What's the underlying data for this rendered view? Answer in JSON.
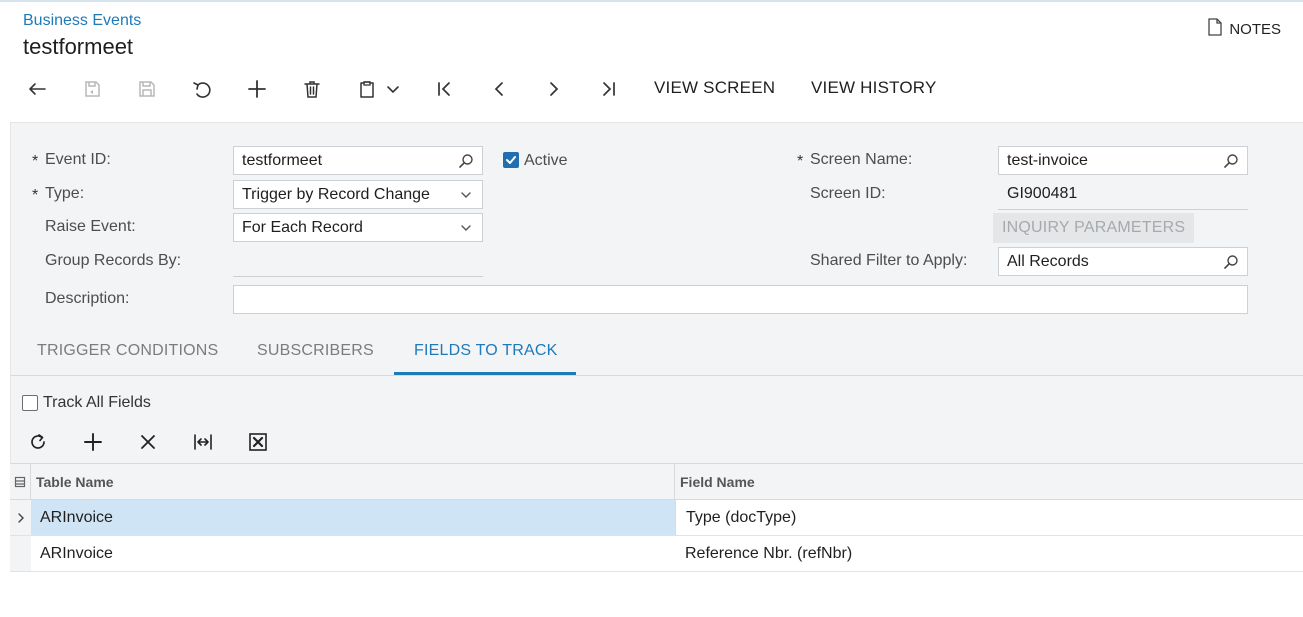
{
  "header": {
    "breadcrumb": "Business Events",
    "title": "testformeet",
    "notes_label": "NOTES"
  },
  "toolbar": {
    "icons": [
      "back-arrow-icon",
      "save-and-close-icon",
      "save-icon",
      "undo-icon",
      "add-icon",
      "delete-icon",
      "copy-paste-icon",
      "first-record-icon",
      "previous-record-icon",
      "next-record-icon",
      "last-record-icon"
    ],
    "view_screen_label": "VIEW SCREEN",
    "view_history_label": "VIEW HISTORY"
  },
  "form": {
    "event_id": {
      "label": "Event ID:",
      "value": "testformeet",
      "required": "*"
    },
    "active": {
      "label": "Active",
      "checked": true
    },
    "type": {
      "label": "Type:",
      "value": "Trigger by Record Change",
      "required": "*"
    },
    "raise_event": {
      "label": "Raise Event:",
      "value": "For Each Record"
    },
    "group_records_by": {
      "label": "Group Records By:",
      "value": ""
    },
    "description": {
      "label": "Description:",
      "value": ""
    },
    "screen_name": {
      "label": "Screen Name:",
      "value": "test-invoice",
      "required": "*"
    },
    "screen_id": {
      "label": "Screen ID:",
      "value": "GI900481"
    },
    "inquiry_parameters_label": "INQUIRY PARAMETERS",
    "shared_filter": {
      "label": "Shared Filter to Apply:",
      "value": "All Records"
    }
  },
  "tabs": [
    {
      "label": "TRIGGER CONDITIONS"
    },
    {
      "label": "SUBSCRIBERS"
    },
    {
      "label": "FIELDS TO TRACK",
      "active": true
    }
  ],
  "fields_to_track": {
    "track_all_label": "Track All Fields",
    "track_all_checked": false,
    "grid_toolbar_icons": [
      "refresh-icon",
      "add-row-icon",
      "delete-row-icon",
      "fit-columns-icon",
      "export-excel-icon"
    ],
    "columns": [
      "Table Name",
      "Field Name"
    ],
    "rows": [
      {
        "table_name": "ARInvoice",
        "field_name": "Type (docType)",
        "selected": true
      },
      {
        "table_name": "ARInvoice",
        "field_name": "Reference Nbr. (refNbr)",
        "selected": false
      }
    ]
  },
  "colors": {
    "accent": "#1f7ab8",
    "selected_row": "#cfe4f4",
    "form_background": "#f3f4f5"
  }
}
